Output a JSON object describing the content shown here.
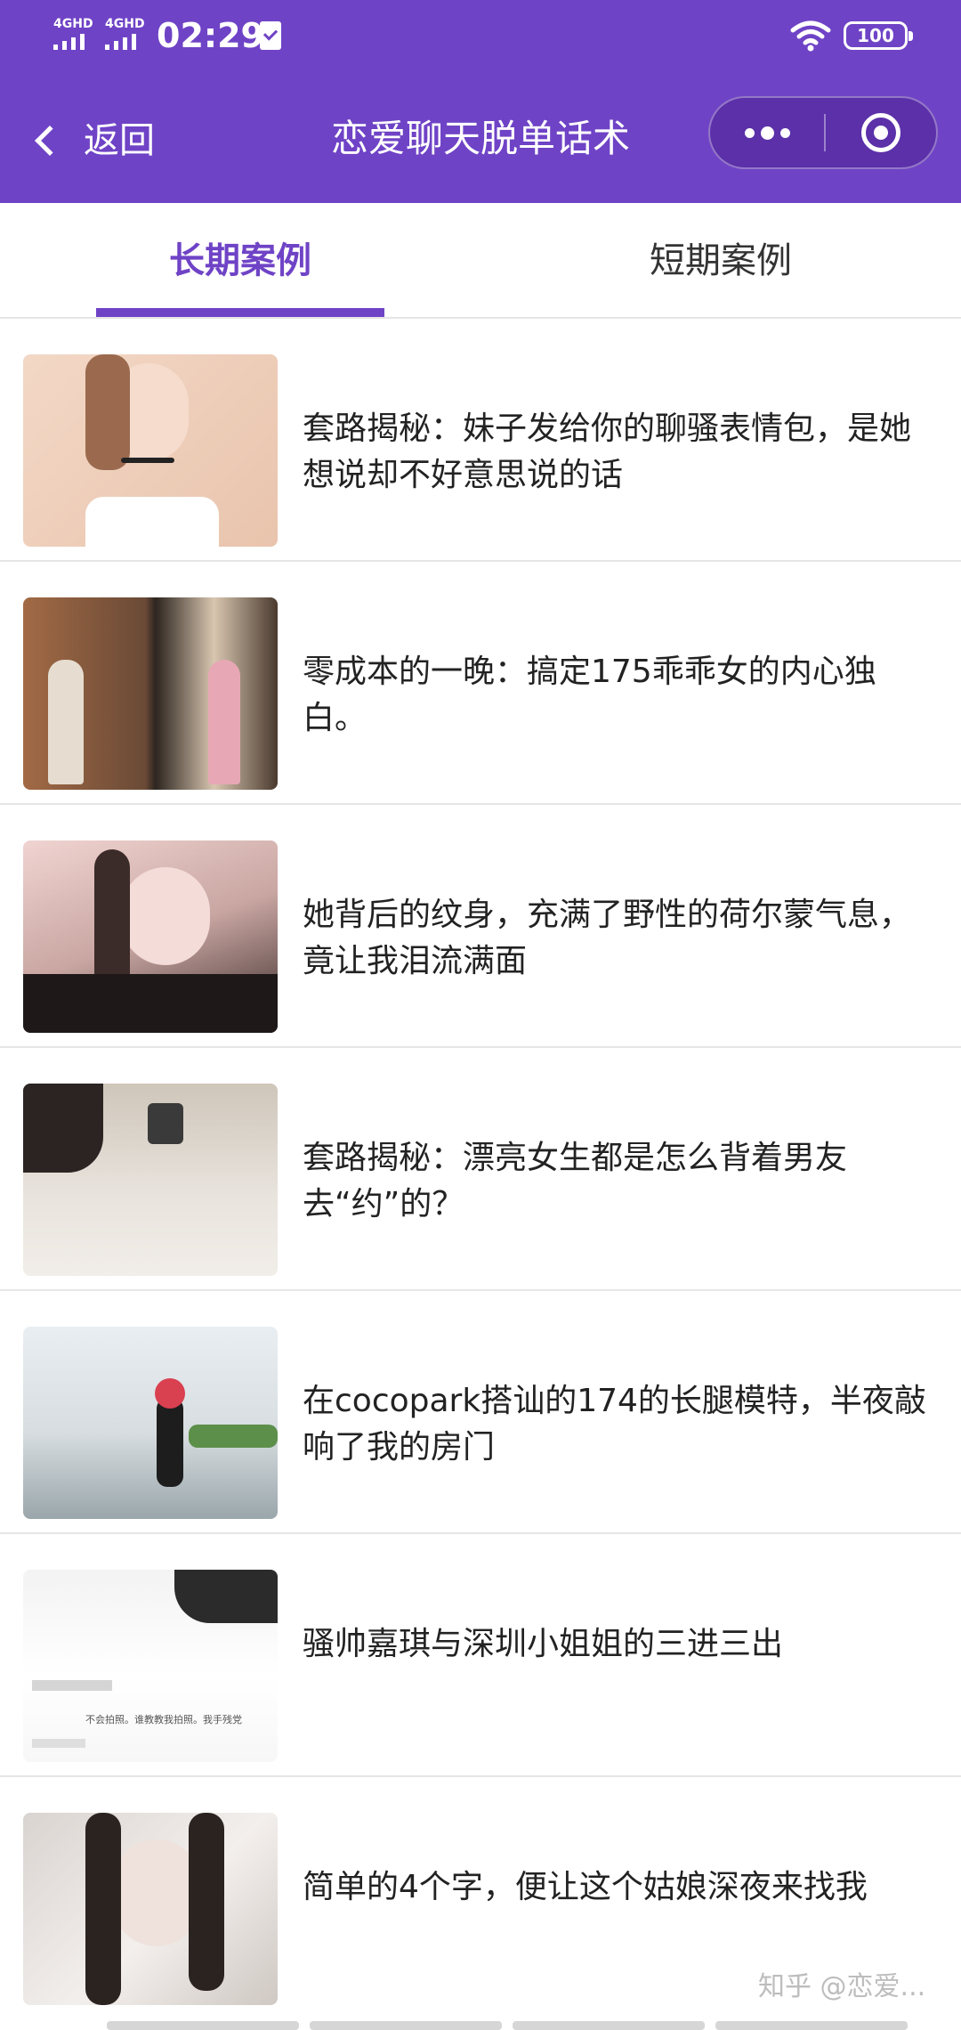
{
  "status_bar": {
    "sim1": "4GHD",
    "sim2": "4GHD",
    "time": "02:29",
    "battery": "100"
  },
  "nav": {
    "back_label": "返回",
    "title": "恋爱聊天脱单话术"
  },
  "tabs": [
    {
      "label": "长期案例",
      "active": true
    },
    {
      "label": "短期案例",
      "active": false
    }
  ],
  "articles": [
    {
      "title": "套路揭秘：妹子发给你的聊骚表情包，是她想说却不好意思说的话"
    },
    {
      "title": "零成本的一晚：搞定175乖乖女的内心独白。"
    },
    {
      "title": "她背后的纹身，充满了野性的荷尔蒙气息，竟让我泪流满面"
    },
    {
      "title": "套路揭秘：漂亮女生都是怎么背着男友去“约”的？"
    },
    {
      "title": "在cocopark搭讪的174的长腿模特，半夜敲响了我的房门"
    },
    {
      "title": "骚帅嘉琪与深圳小姐姐的三进三出"
    },
    {
      "title": "简单的4个字，便让这个姑娘深夜来找我"
    }
  ],
  "thumbnail_6_caption": "不会拍照。谁教教我拍照。我手残党",
  "watermark": "知乎 @恋爱..."
}
